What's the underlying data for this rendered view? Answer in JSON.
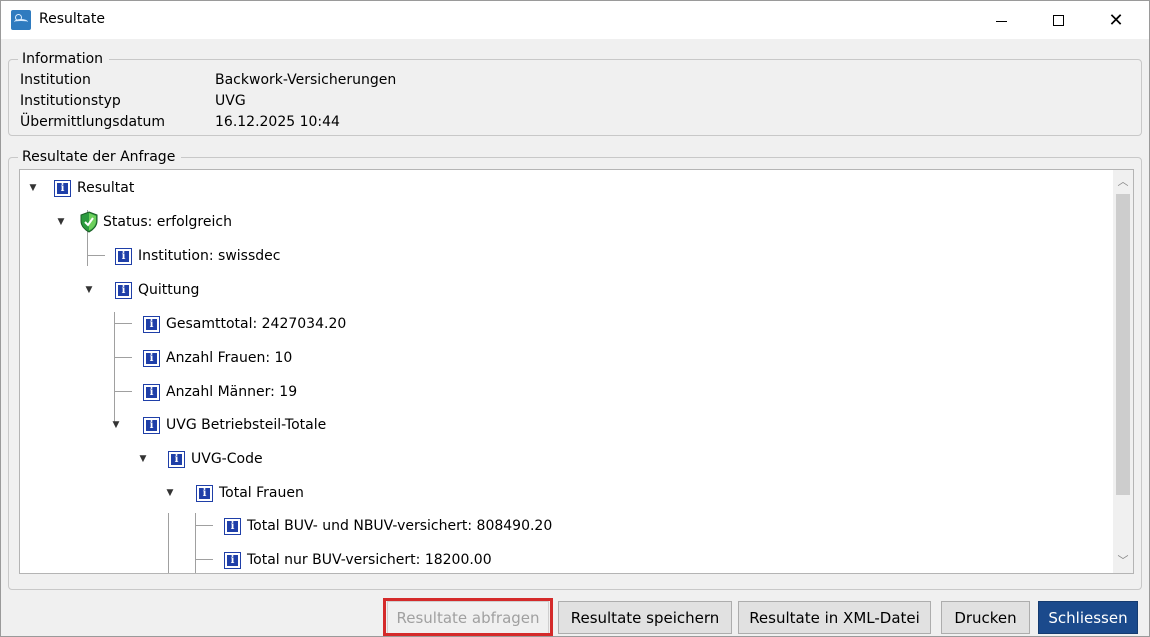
{
  "window": {
    "title": "Resultate",
    "controls": {
      "minimize": "minimize-icon",
      "maximize": "maximize-icon",
      "close": "close-icon"
    }
  },
  "information": {
    "legend": "Information",
    "rows": [
      {
        "label": "Institution",
        "value": "Backwork-Versicherungen"
      },
      {
        "label": "Institutionstyp",
        "value": "UVG"
      },
      {
        "label": "Übermittlungsdatum",
        "value": "16.12.2025 10:44"
      }
    ]
  },
  "results": {
    "legend": "Resultate der Anfrage",
    "tree": [
      {
        "label": "Resultat",
        "icon": "info-icon",
        "expanded": true
      },
      {
        "label": "Status: erfolgreich",
        "icon": "shield-check-icon",
        "expanded": true
      },
      {
        "label": "Institution: swissdec",
        "icon": "info-icon"
      },
      {
        "label": "Quittung",
        "icon": "info-icon",
        "expanded": true
      },
      {
        "label": "Gesamttotal: 2427034.20",
        "icon": "info-icon"
      },
      {
        "label": "Anzahl Frauen: 10",
        "icon": "info-icon"
      },
      {
        "label": "Anzahl Männer: 19",
        "icon": "info-icon"
      },
      {
        "label": "UVG Betriebsteil-Totale",
        "icon": "info-icon",
        "expanded": true
      },
      {
        "label": "UVG-Code",
        "icon": "info-icon",
        "expanded": true
      },
      {
        "label": "Total Frauen",
        "icon": "info-icon",
        "expanded": true
      },
      {
        "label": "Total BUV- und NBUV-versichert: 808490.20",
        "icon": "info-icon"
      },
      {
        "label": "Total nur BUV-versichert: 18200.00",
        "icon": "info-icon"
      }
    ]
  },
  "buttons": {
    "query": "Resultate abfragen",
    "save": "Resultate speichern",
    "xml": "Resultate in XML-Datei",
    "print": "Drucken",
    "close": "Schliessen"
  },
  "colors": {
    "primary_button": "#1b4a8c",
    "highlight": "#d42a2a",
    "info_icon": "#1f3fa8"
  }
}
